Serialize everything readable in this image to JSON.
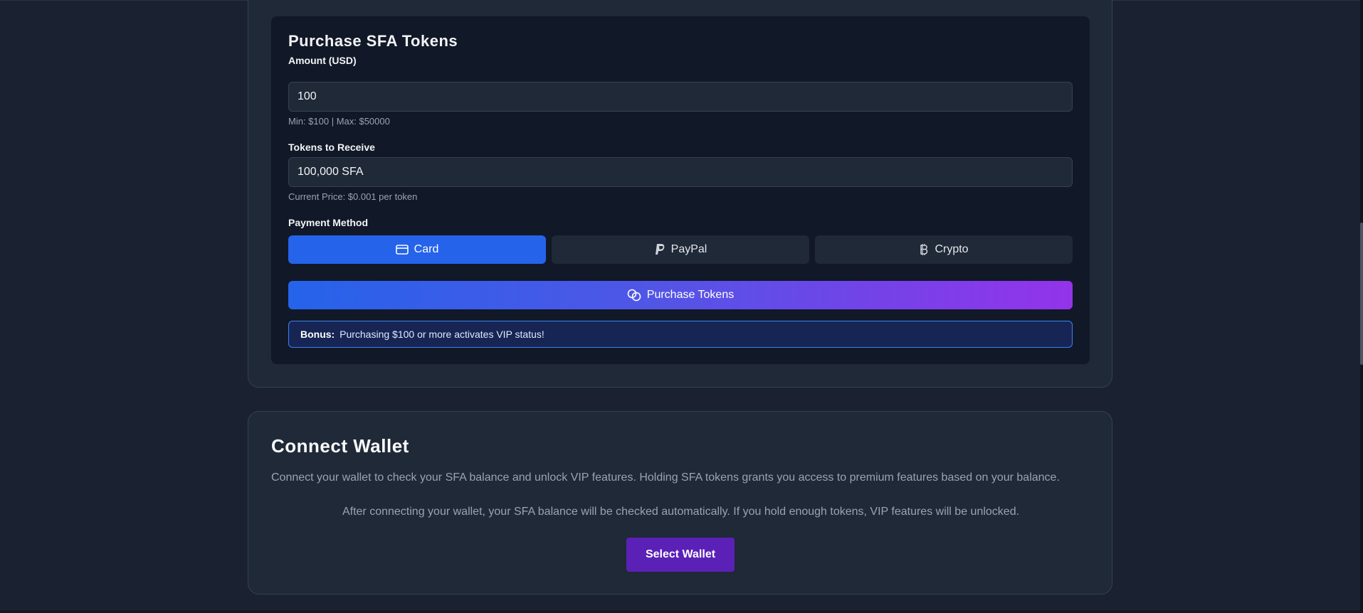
{
  "purchase": {
    "title": "Purchase SFA Tokens",
    "amount_label": "Amount (USD)",
    "amount_value": "100",
    "amount_hint": "Min: $100 | Max: $50000",
    "tokens_label": "Tokens to Receive",
    "tokens_value": "100,000 SFA",
    "tokens_hint": "Current Price: $0.001 per token",
    "payment_label": "Payment Method",
    "methods": [
      {
        "label": "Card",
        "icon": "credit-card-icon",
        "active": true
      },
      {
        "label": "PayPal",
        "icon": "paypal-icon",
        "active": false
      },
      {
        "label": "Crypto",
        "icon": "bitcoin-icon",
        "active": false
      }
    ],
    "purchase_button": "Purchase Tokens",
    "purchase_icon": "coins-icon",
    "bonus_label": "Bonus:",
    "bonus_text": "Purchasing $100 or more activates VIP status!"
  },
  "wallet": {
    "title": "Connect Wallet",
    "description": "Connect your wallet to check your SFA balance and unlock VIP features. Holding SFA tokens grants you access to premium features based on your balance.",
    "note": "After connecting your wallet, your SFA balance will be checked automatically. If you hold enough tokens, VIP features will be unlocked.",
    "select_button": "Select Wallet"
  },
  "colors": {
    "page_bg": "#1a2231",
    "card_bg": "#1f2937",
    "panel_bg": "#111827",
    "accent_blue": "#2563eb",
    "accent_purple": "#9333ea",
    "wallet_button": "#5b21b6"
  }
}
